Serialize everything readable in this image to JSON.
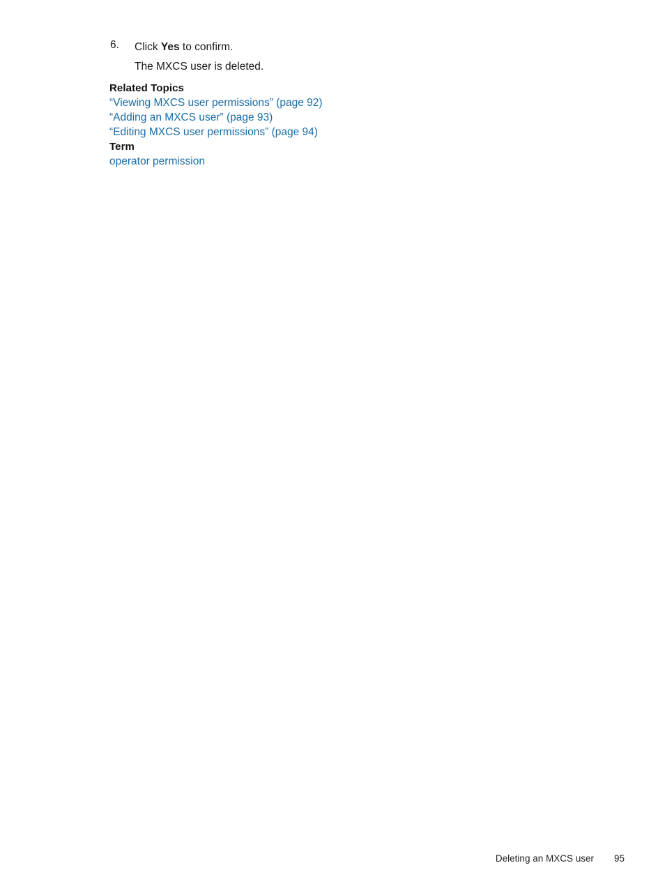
{
  "document": {
    "page_number": "95",
    "link_color": "#1a6ca8",
    "text_color": "#1a1a1a"
  },
  "step": {
    "number": "6.",
    "line1_prefix": "Click ",
    "line1_bold": "Yes",
    "line1_suffix": " to confirm.",
    "line2": "The MXCS user is deleted."
  },
  "related_topics": {
    "heading": "Related Topics",
    "links": [
      "“Viewing MXCS user permissions” (page 92)",
      "“Adding an MXCS user” (page 93)",
      "“Editing MXCS user permissions” (page 94)"
    ]
  },
  "term": {
    "heading": "Term",
    "links": [
      "operator permission"
    ]
  },
  "footer": {
    "title": "Deleting an MXCS user",
    "page": "95"
  }
}
